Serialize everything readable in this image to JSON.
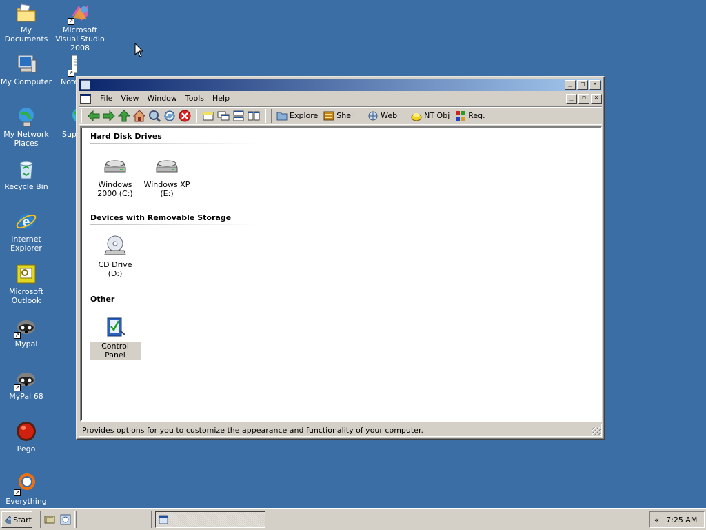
{
  "desktop": {
    "icons": [
      {
        "label": "My Documents",
        "icon": "my-documents-icon"
      },
      {
        "label": "Microsoft Visual Studio 2008",
        "icon": "visual-studio-icon"
      },
      {
        "label": "My Computer",
        "icon": "my-computer-icon"
      },
      {
        "label": "Notepad",
        "icon": "notepad-icon",
        "visible_label": "Note"
      },
      {
        "label": "My Network Places",
        "icon": "network-places-icon"
      },
      {
        "label": "Super",
        "icon": "globe-icon",
        "visible_label": "Supe"
      },
      {
        "label": "Recycle Bin",
        "icon": "recycle-bin-icon"
      },
      {
        "label": "Internet Explorer",
        "icon": "internet-explorer-icon"
      },
      {
        "label": "Microsoft Outlook",
        "icon": "outlook-icon"
      },
      {
        "label": "Mypal",
        "icon": "raccoon-icon"
      },
      {
        "label": "MyPal 68",
        "icon": "raccoon-icon"
      },
      {
        "label": "Pego",
        "icon": "red-ball-icon"
      },
      {
        "label": "Everything",
        "icon": "magnifier-icon"
      }
    ]
  },
  "window": {
    "menu": [
      "File",
      "View",
      "Window",
      "Tools",
      "Help"
    ],
    "toolbar": {
      "labeled_buttons": [
        {
          "label": "Explore",
          "icon": "folder-icon"
        },
        {
          "label": "Shell",
          "icon": "shell-icon"
        },
        {
          "label": "Web",
          "icon": "web-icon"
        },
        {
          "label": "NT Obj",
          "icon": "nt-obj-icon"
        },
        {
          "label": "Reg.",
          "icon": "registry-icon"
        }
      ]
    },
    "groups": [
      {
        "title": "Hard Disk Drives",
        "items": [
          {
            "label": "Windows 2000 (C:)",
            "icon": "hard-disk-icon"
          },
          {
            "label": "Windows XP (E:)",
            "icon": "hard-disk-icon"
          }
        ]
      },
      {
        "title": "Devices with Removable Storage",
        "items": [
          {
            "label": "CD Drive (D:)",
            "icon": "cd-drive-icon"
          }
        ]
      },
      {
        "title": "Other",
        "items": [
          {
            "label": "Control Panel",
            "icon": "control-panel-icon",
            "selected": true
          }
        ]
      }
    ],
    "status": "Provides options for you to customize the appearance and functionality of your computer."
  },
  "taskbar": {
    "start_label": "Start",
    "clock": "7:25 AM",
    "tray_chevron": "«"
  }
}
